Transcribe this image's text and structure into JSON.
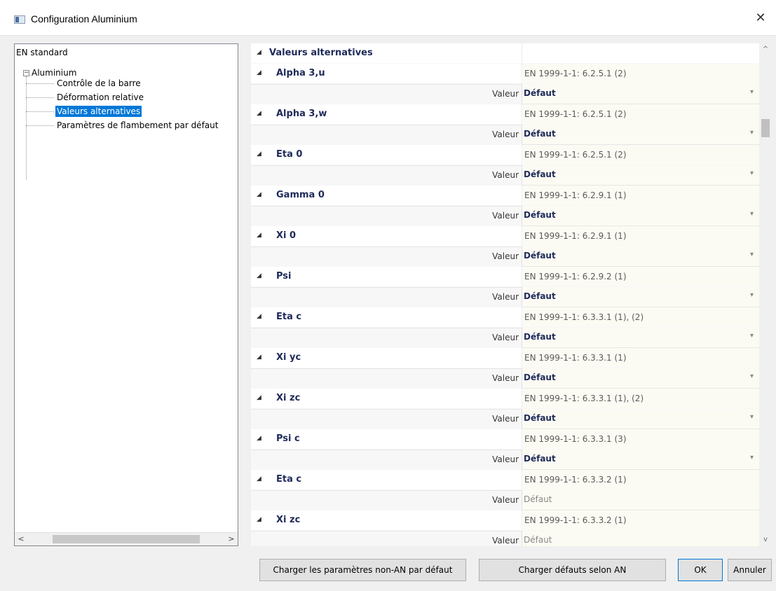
{
  "window": {
    "title": "Configuration Aluminium",
    "close_symbol": "✕"
  },
  "tree": {
    "root": "EN standard",
    "group": "Aluminium",
    "children": [
      "Contrôle de la barre",
      "Déformation relative",
      "Valeurs alternatives",
      "Paramètres de flambement par défaut"
    ],
    "selected_index": 2
  },
  "grid": {
    "section_title": "Valeurs alternatives",
    "value_label": "Valeur",
    "params": [
      {
        "name": "Alpha 3,u",
        "ref": "EN 1999-1-1: 6.2.5.1 (2)",
        "value": "Défaut",
        "dropdown": true
      },
      {
        "name": "Alpha 3,w",
        "ref": "EN 1999-1-1: 6.2.5.1 (2)",
        "value": "Défaut",
        "dropdown": true
      },
      {
        "name": "Eta 0",
        "ref": "EN 1999-1-1: 6.2.5.1 (2)",
        "value": "Défaut",
        "dropdown": true
      },
      {
        "name": "Gamma 0",
        "ref": "EN 1999-1-1: 6.2.9.1 (1)",
        "value": "Défaut",
        "dropdown": true
      },
      {
        "name": "Xi 0",
        "ref": "EN 1999-1-1: 6.2.9.1 (1)",
        "value": "Défaut",
        "dropdown": true
      },
      {
        "name": "Psi",
        "ref": "EN 1999-1-1: 6.2.9.2 (1)",
        "value": "Défaut",
        "dropdown": true
      },
      {
        "name": "Eta c",
        "ref": "EN 1999-1-1: 6.3.3.1 (1), (2)",
        "value": "Défaut",
        "dropdown": true
      },
      {
        "name": "Xi yc",
        "ref": "EN 1999-1-1: 6.3.3.1 (1)",
        "value": "Défaut",
        "dropdown": true
      },
      {
        "name": "Xi zc",
        "ref": "EN 1999-1-1: 6.3.3.1 (1), (2)",
        "value": "Défaut",
        "dropdown": true
      },
      {
        "name": "Psi c",
        "ref": "EN 1999-1-1: 6.3.3.1 (3)",
        "value": "Défaut",
        "dropdown": true
      },
      {
        "name": "Eta c",
        "ref": "EN 1999-1-1: 6.3.3.2 (1)",
        "value": "Défaut",
        "dropdown": false
      },
      {
        "name": "Xi zc",
        "ref": "EN 1999-1-1: 6.3.3.2 (1)",
        "value": "Défaut",
        "dropdown": false
      }
    ]
  },
  "buttons": {
    "load_non_an": "Charger les paramètres non-AN par défaut",
    "load_an": "Charger défauts selon AN",
    "ok": "OK",
    "cancel": "Annuler"
  },
  "colors": {
    "selection": "#0078d7",
    "param_text": "#1e2a5a",
    "value_bg": "#fcfbf3"
  }
}
